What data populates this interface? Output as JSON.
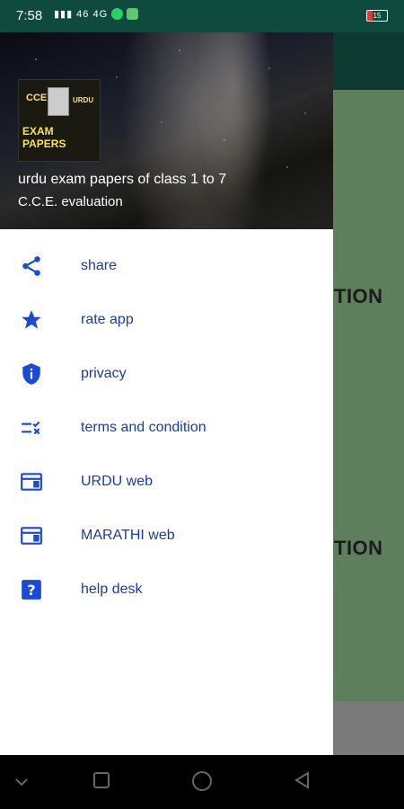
{
  "status_bar": {
    "time": "7:58",
    "network_text": "46 4G",
    "battery": "15"
  },
  "drawer": {
    "logo": {
      "cce": "CCE",
      "urdu": "URDU",
      "exam_papers": "EXAM PAPERS"
    },
    "title": "urdu exam papers of class 1 to 7",
    "subtitle": "C.C.E. evaluation",
    "items": [
      {
        "label": "share",
        "icon": "share-icon"
      },
      {
        "label": "rate app",
        "icon": "star-icon"
      },
      {
        "label": "privacy",
        "icon": "shield-icon"
      },
      {
        "label": "terms and condition",
        "icon": "checklist-icon"
      },
      {
        "label": "URDU web",
        "icon": "web-icon"
      },
      {
        "label": "MARATHI web",
        "icon": "web-icon"
      },
      {
        "label": "help desk",
        "icon": "help-icon"
      }
    ],
    "accent_color": "#1a3aa8",
    "icon_color": "#1a4ad6"
  },
  "background": {
    "card1_text": "TION",
    "card2_text": "TION"
  },
  "navbar": {
    "icons": [
      "chevron-down-icon",
      "square-icon",
      "circle-icon",
      "triangle-back-icon"
    ]
  }
}
